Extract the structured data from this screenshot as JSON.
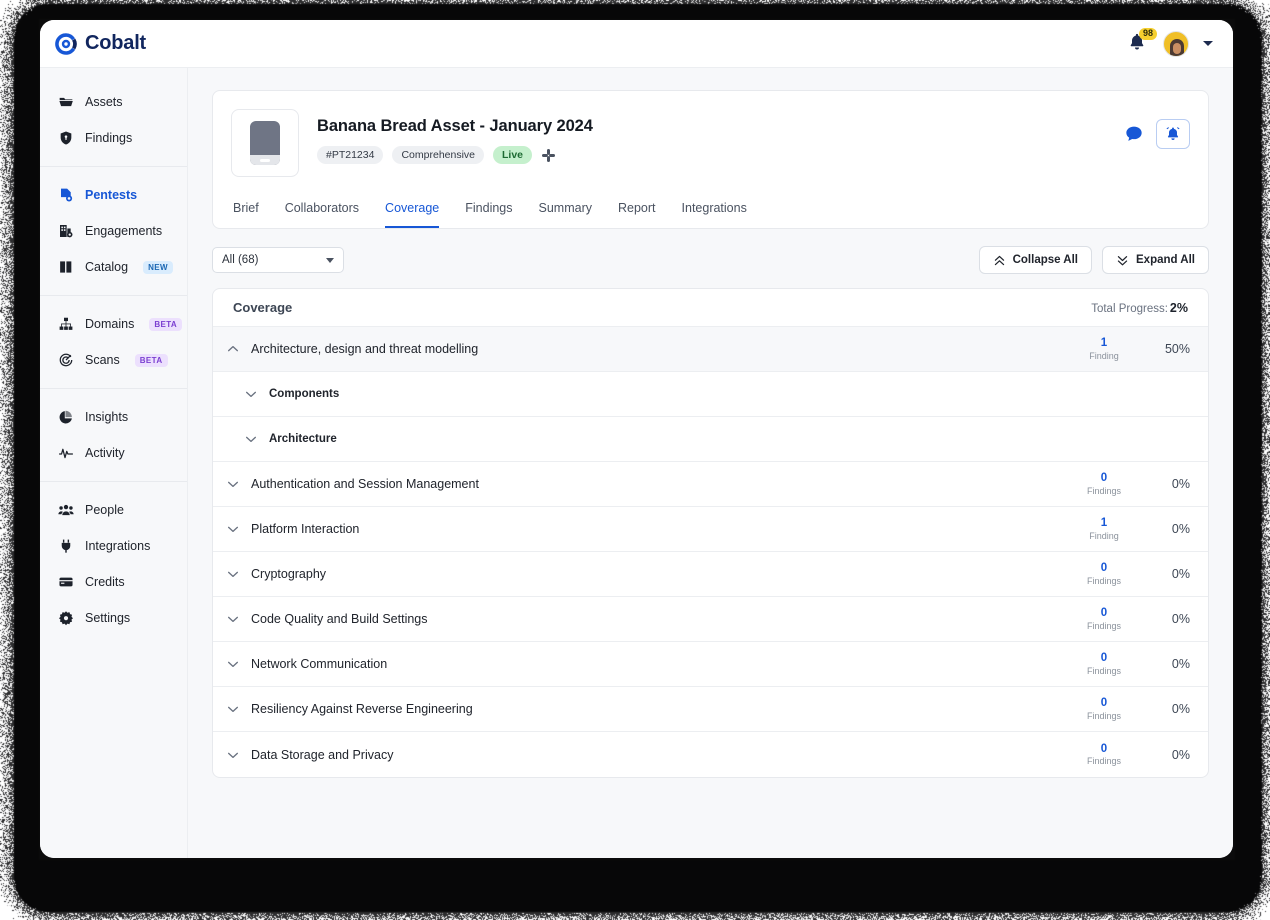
{
  "brand": {
    "name": "Cobalt",
    "logo_icon": "cobalt-gear-logo",
    "color": "#11265e"
  },
  "topbar": {
    "notifications_icon": "bell-icon",
    "notifications_count": "98",
    "avatar_icon": "user-avatar",
    "account_caret_icon": "chevron-down-icon"
  },
  "sidebar": {
    "groups": [
      {
        "items": [
          {
            "label": "Assets",
            "icon": "folder-icon",
            "active": false
          },
          {
            "label": "Findings",
            "icon": "shield-icon",
            "active": false
          }
        ]
      },
      {
        "items": [
          {
            "label": "Pentests",
            "icon": "file-shield-icon",
            "active": true
          },
          {
            "label": "Engagements",
            "icon": "building-shield-icon",
            "active": false
          },
          {
            "label": "Catalog",
            "icon": "book-icon",
            "active": false,
            "badge": "NEW",
            "badge_type": "new"
          }
        ]
      },
      {
        "items": [
          {
            "label": "Domains",
            "icon": "sitemap-icon",
            "active": false,
            "badge": "BETA",
            "badge_type": "beta"
          },
          {
            "label": "Scans",
            "icon": "target-icon",
            "active": false,
            "badge": "BETA",
            "badge_type": "beta"
          }
        ]
      },
      {
        "items": [
          {
            "label": "Insights",
            "icon": "pie-chart-icon",
            "active": false
          },
          {
            "label": "Activity",
            "icon": "pulse-icon",
            "active": false
          }
        ]
      },
      {
        "items": [
          {
            "label": "People",
            "icon": "people-icon",
            "active": false
          },
          {
            "label": "Integrations",
            "icon": "plug-icon",
            "active": false
          },
          {
            "label": "Credits",
            "icon": "wallet-icon",
            "active": false
          },
          {
            "label": "Settings",
            "icon": "gear-icon",
            "active": false
          }
        ]
      }
    ]
  },
  "asset": {
    "thumbnail_icon": "mobile-device-icon",
    "title": "Banana Bread Asset - January 2024",
    "badges": [
      {
        "label": "#PT21234",
        "type": "default"
      },
      {
        "label": "Comprehensive",
        "type": "default"
      },
      {
        "label": "Live",
        "type": "live"
      }
    ],
    "slack_icon": "slack-icon",
    "actions": {
      "comment_icon": "chat-bubble-icon",
      "notify_icon": "bell-icon"
    }
  },
  "tabs": [
    {
      "label": "Brief",
      "active": false
    },
    {
      "label": "Collaborators",
      "active": false
    },
    {
      "label": "Coverage",
      "active": true
    },
    {
      "label": "Findings",
      "active": false
    },
    {
      "label": "Summary",
      "active": false
    },
    {
      "label": "Report",
      "active": false
    },
    {
      "label": "Integrations",
      "active": false
    }
  ],
  "toolbar": {
    "filter_value": "All (68)",
    "filter_caret_icon": "chevron-down-icon",
    "collapse_label": "Collapse All",
    "collapse_icon": "double-chevron-up-icon",
    "expand_label": "Expand All",
    "expand_icon": "double-chevron-down-icon"
  },
  "coverage": {
    "title": "Coverage",
    "progress_label": "Total Progress:",
    "progress_value": "2%",
    "rows": [
      {
        "name": "Architecture, design and threat modelling",
        "findings": "1",
        "findings_label": "Finding",
        "percent": "50%",
        "expanded": true,
        "sub": false,
        "chevron": "chevron-up-icon"
      },
      {
        "name": "Components",
        "findings": "",
        "findings_label": "",
        "percent": "",
        "expanded": false,
        "sub": true,
        "chevron": "chevron-down-icon"
      },
      {
        "name": "Architecture",
        "findings": "",
        "findings_label": "",
        "percent": "",
        "expanded": false,
        "sub": true,
        "chevron": "chevron-down-icon"
      },
      {
        "name": "Authentication and Session Management",
        "findings": "0",
        "findings_label": "Findings",
        "percent": "0%",
        "expanded": false,
        "sub": false,
        "chevron": "chevron-down-icon"
      },
      {
        "name": "Platform Interaction",
        "findings": "1",
        "findings_label": "Finding",
        "percent": "0%",
        "expanded": false,
        "sub": false,
        "chevron": "chevron-down-icon"
      },
      {
        "name": "Cryptography",
        "findings": "0",
        "findings_label": "Findings",
        "percent": "0%",
        "expanded": false,
        "sub": false,
        "chevron": "chevron-down-icon"
      },
      {
        "name": "Code Quality and Build Settings",
        "findings": "0",
        "findings_label": "Findings",
        "percent": "0%",
        "expanded": false,
        "sub": false,
        "chevron": "chevron-down-icon"
      },
      {
        "name": "Network Communication",
        "findings": "0",
        "findings_label": "Findings",
        "percent": "0%",
        "expanded": false,
        "sub": false,
        "chevron": "chevron-down-icon"
      },
      {
        "name": "Resiliency Against Reverse Engineering",
        "findings": "0",
        "findings_label": "Findings",
        "percent": "0%",
        "expanded": false,
        "sub": false,
        "chevron": "chevron-down-icon"
      },
      {
        "name": "Data Storage and Privacy",
        "findings": "0",
        "findings_label": "Findings",
        "percent": "0%",
        "expanded": false,
        "sub": false,
        "chevron": "chevron-down-icon"
      }
    ]
  },
  "colors": {
    "accent": "#1757d6",
    "brand": "#11265e",
    "live": "#c5f0cd",
    "badge_yellow": "#f5cf2e"
  }
}
